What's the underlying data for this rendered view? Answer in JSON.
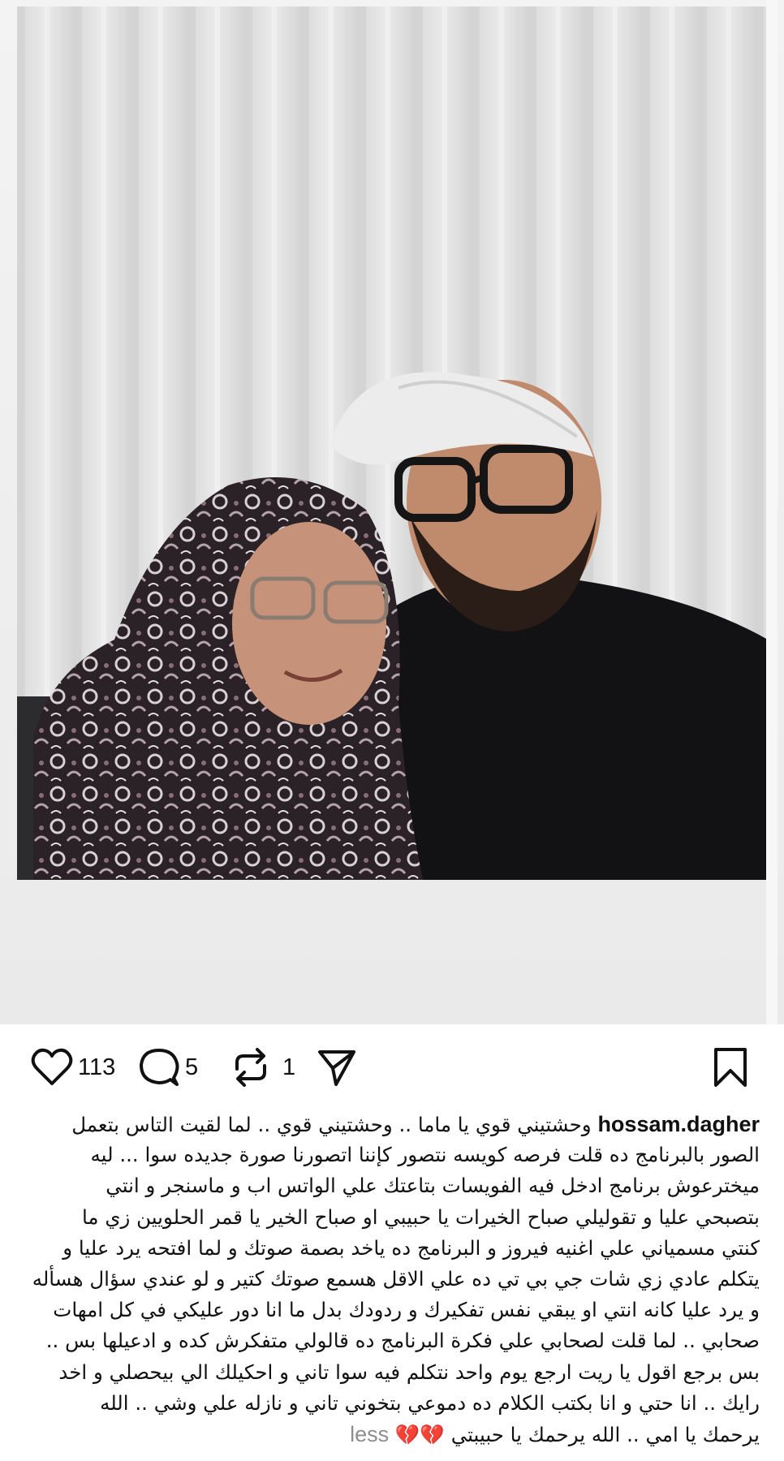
{
  "post": {
    "username": "hossam.dagher",
    "likes": "113",
    "comments": "5",
    "reposts": "1",
    "photo_alt": "Selfie of a young man in a white cap and glasses with an older woman in a patterned hijab"
  },
  "icons": {
    "like": "heart-icon",
    "comment": "comment-bubble-icon",
    "repost": "repost-icon",
    "share": "send-icon",
    "save": "bookmark-icon"
  },
  "caption": {
    "line1": "وحشتيني قوي يا ماما .. وحشتيني قوي .. لما لقيت التاس بتعمل",
    "line2": "الصور بالبرنامج ده قلت فرصه كويسه نتصور كإننا اتصورنا صورة جديده سوا ... ليه",
    "line3": "ميخترعوش برنامج ادخل فيه الفويسات بتاعتك علي الواتس اب و ماسنجر و انتي",
    "line4": "بتصبحي عليا و تقوليلي صباح الخيرات يا حبيبي او صباح الخير يا قمر الحلويين زي ما",
    "line5": "كنتي مسمياني علي اغنيه فيروز  و البرنامج ده ياخد بصمة صوتك و لما افتحه يرد عليا و",
    "line6": "يتكلم عادي زي شات جي بي تي ده علي الاقل هسمع صوتك كتير و لو عندي سؤال هسأله",
    "line7": "و يرد عليا كانه انتي او يبقي نفس تفكيرك و ردودك بدل ما انا دور عليكي في كل امهات",
    "line8": "صحابي .. لما قلت لصحابي علي فكرة البرنامج ده قالولي متفكرش كده و ادعيلها بس ..",
    "line9": "بس برجع اقول يا ريت ارجع يوم واحد نتكلم فيه سوا تاني و احكيلك الي بيحصلي و اخد",
    "line10": "رايك .. انا حتي و انا بكتب الكلام ده دموعي بتخوني تاني و نازله علي وشي .. الله",
    "line11": "يرحمك يا امي .. الله يرحمك يا حبيبتي",
    "hearts": "💔💔",
    "less_label": "less"
  },
  "colors": {
    "text": "#111111",
    "muted": "#8e8e8e",
    "heart": "#c4364a",
    "frame": "#eeeeee"
  }
}
